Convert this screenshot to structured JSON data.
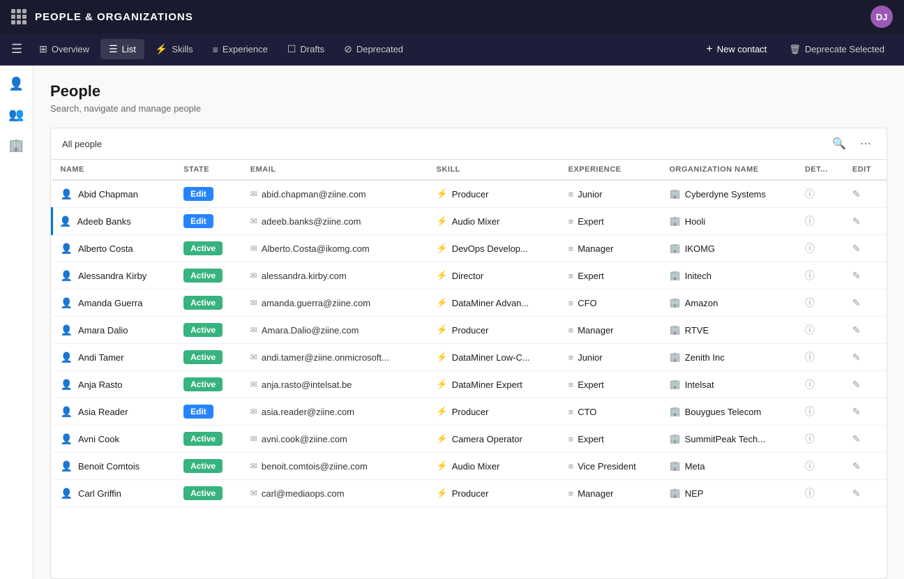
{
  "topbar": {
    "title": "PEOPLE & ORGANIZATIONS",
    "avatar_initials": "DJ"
  },
  "navtabs": {
    "items": [
      {
        "id": "overview",
        "label": "Overview",
        "icon": "⊞"
      },
      {
        "id": "list",
        "label": "List",
        "icon": "☰"
      },
      {
        "id": "skills",
        "label": "Skills",
        "icon": "⚡"
      },
      {
        "id": "experience",
        "label": "Experience",
        "icon": "≡"
      },
      {
        "id": "drafts",
        "label": "Drafts",
        "icon": "□"
      },
      {
        "id": "deprecated",
        "label": "Deprecated",
        "icon": "⊘"
      }
    ],
    "new_contact_label": "New contact",
    "deprecate_label": "Deprecate Selected"
  },
  "sidebar": {
    "items": [
      {
        "id": "person",
        "icon": "👤"
      },
      {
        "id": "group",
        "icon": "👥"
      },
      {
        "id": "building",
        "icon": "🏢"
      }
    ]
  },
  "page": {
    "title": "People",
    "subtitle": "Search, navigate and manage people"
  },
  "table": {
    "filter_label": "All people",
    "columns": [
      "NAME",
      "STATE",
      "EMAIL",
      "SKILL",
      "EXPERIENCE",
      "ORGANIZATION NAME",
      "DET...",
      "EDIT"
    ],
    "rows": [
      {
        "name": "Abid Chapman",
        "state": "Edit",
        "state_type": "edit",
        "email": "abid.chapman@ziine.com",
        "skill": "Producer",
        "experience": "Junior",
        "org": "Cyberdyne Systems",
        "selected": false
      },
      {
        "name": "Adeeb Banks",
        "state": "Edit",
        "state_type": "edit",
        "email": "adeeb.banks@ziine.com",
        "skill": "Audio Mixer",
        "experience": "Expert",
        "org": "Hooli",
        "selected": true
      },
      {
        "name": "Alberto Costa",
        "state": "Active",
        "state_type": "active",
        "email": "Alberto.Costa@ikomg.com",
        "skill": "DevOps Develop...",
        "experience": "Manager",
        "org": "IKOMG",
        "selected": false
      },
      {
        "name": "Alessandra Kirby",
        "state": "Active",
        "state_type": "active",
        "email": "alessandra.kirby.com",
        "skill": "Director",
        "experience": "Expert",
        "org": "Initech",
        "selected": false
      },
      {
        "name": "Amanda Guerra",
        "state": "Active",
        "state_type": "active",
        "email": "amanda.guerra@ziine.com",
        "skill": "DataMiner Advan...",
        "experience": "CFO",
        "org": "Amazon",
        "selected": false
      },
      {
        "name": "Amara Dalio",
        "state": "Active",
        "state_type": "active",
        "email": "Amara.Dalio@ziine.com",
        "skill": "Producer",
        "experience": "Manager",
        "org": "RTVE",
        "selected": false
      },
      {
        "name": "Andi Tamer",
        "state": "Active",
        "state_type": "active",
        "email": "andi.tamer@ziine.onmicrosoft...",
        "skill": "DataMiner Low-C...",
        "experience": "Junior",
        "org": "Zenith Inc",
        "selected": false
      },
      {
        "name": "Anja Rasto",
        "state": "Active",
        "state_type": "active",
        "email": "anja.rasto@intelsat.be",
        "skill": "DataMiner Expert",
        "experience": "Expert",
        "org": "Intelsat",
        "selected": false
      },
      {
        "name": "Asia Reader",
        "state": "Edit",
        "state_type": "edit",
        "email": "asia.reader@ziine.com",
        "skill": "Producer",
        "experience": "CTO",
        "org": "Bouygues Telecom",
        "selected": false
      },
      {
        "name": "Avni Cook",
        "state": "Active",
        "state_type": "active",
        "email": "avni.cook@ziine.com",
        "skill": "Camera Operator",
        "experience": "Expert",
        "org": "SummitPeak Tech...",
        "selected": false
      },
      {
        "name": "Benoit Comtois",
        "state": "Active",
        "state_type": "active",
        "email": "benoit.comtois@ziine.com",
        "skill": "Audio Mixer",
        "experience": "Vice President",
        "org": "Meta",
        "selected": false
      },
      {
        "name": "Carl Griffin",
        "state": "Active",
        "state_type": "active",
        "email": "carl@mediaops.com",
        "skill": "Producer",
        "experience": "Manager",
        "org": "NEP",
        "selected": false
      }
    ]
  }
}
